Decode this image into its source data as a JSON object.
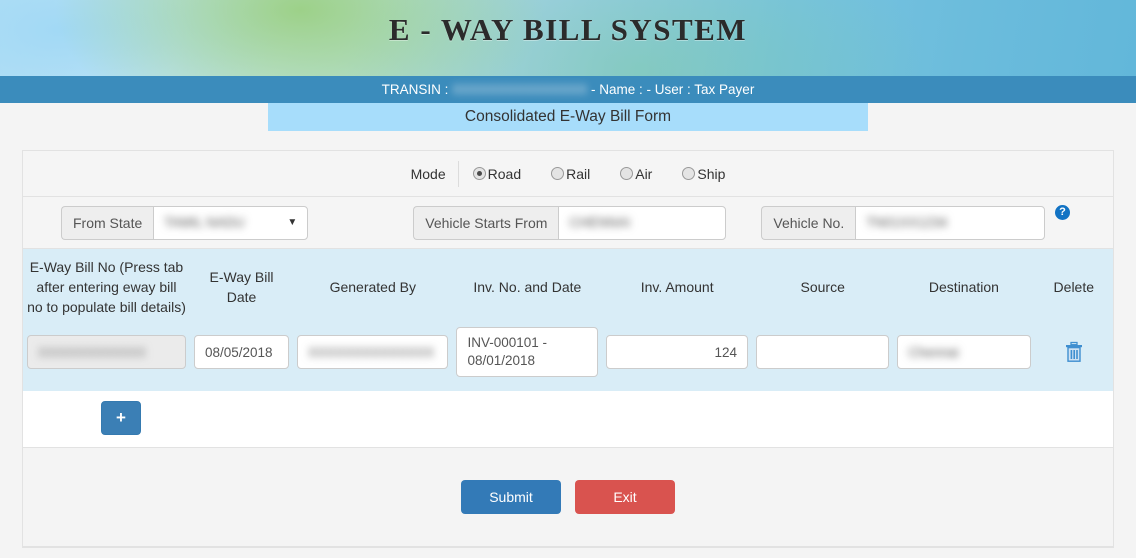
{
  "banner": {
    "title": "E - WAY BILL SYSTEM"
  },
  "transin": {
    "prefix": "TRANSIN : ",
    "value_masked": "XXXXXXXXXXXXXXX",
    "suffix": " - Name : - User : Tax Payer"
  },
  "form": {
    "title": "Consolidated E-Way Bill Form"
  },
  "mode": {
    "label": "Mode",
    "options": [
      {
        "label": "Road",
        "selected": true
      },
      {
        "label": "Rail",
        "selected": false
      },
      {
        "label": "Air",
        "selected": false
      },
      {
        "label": "Ship",
        "selected": false
      }
    ]
  },
  "fields": {
    "from_state": {
      "label": "From State",
      "value_masked": "TAMIL NADU",
      "caret": "▼"
    },
    "vehicle_starts_from": {
      "label": "Vehicle Starts From",
      "value_masked": "CHENNAI"
    },
    "vehicle_no": {
      "label": "Vehicle No.",
      "value_masked": "TN01XX1234"
    },
    "help_icon": "?"
  },
  "table": {
    "headers": [
      "E-Way Bill No (Press tab after entering eway bill no to populate bill details)",
      "E-Way Bill Date",
      "Generated By",
      "Inv. No. and Date",
      "Inv. Amount",
      "Source",
      "Destination",
      "Delete"
    ],
    "rows": [
      {
        "eway_bill_no": "XXXXXXXXXXXX",
        "eway_bill_date": "08/05/2018",
        "generated_by": "XXXXXXXXXXXXXX",
        "inv_no_and_date": "INV-000101 - 08/01/2018",
        "inv_amount": "124",
        "source": "",
        "destination": "Chennai",
        "delete_icon": "trash-icon"
      }
    ],
    "add_button": "+"
  },
  "actions": {
    "submit": "Submit",
    "exit": "Exit"
  },
  "colors": {
    "accent_blue": "#337ab7",
    "danger_red": "#d9534f",
    "bar_blue": "#3b8cbc",
    "title_band": "#a7ddfb",
    "table_band": "#d9edf7"
  }
}
